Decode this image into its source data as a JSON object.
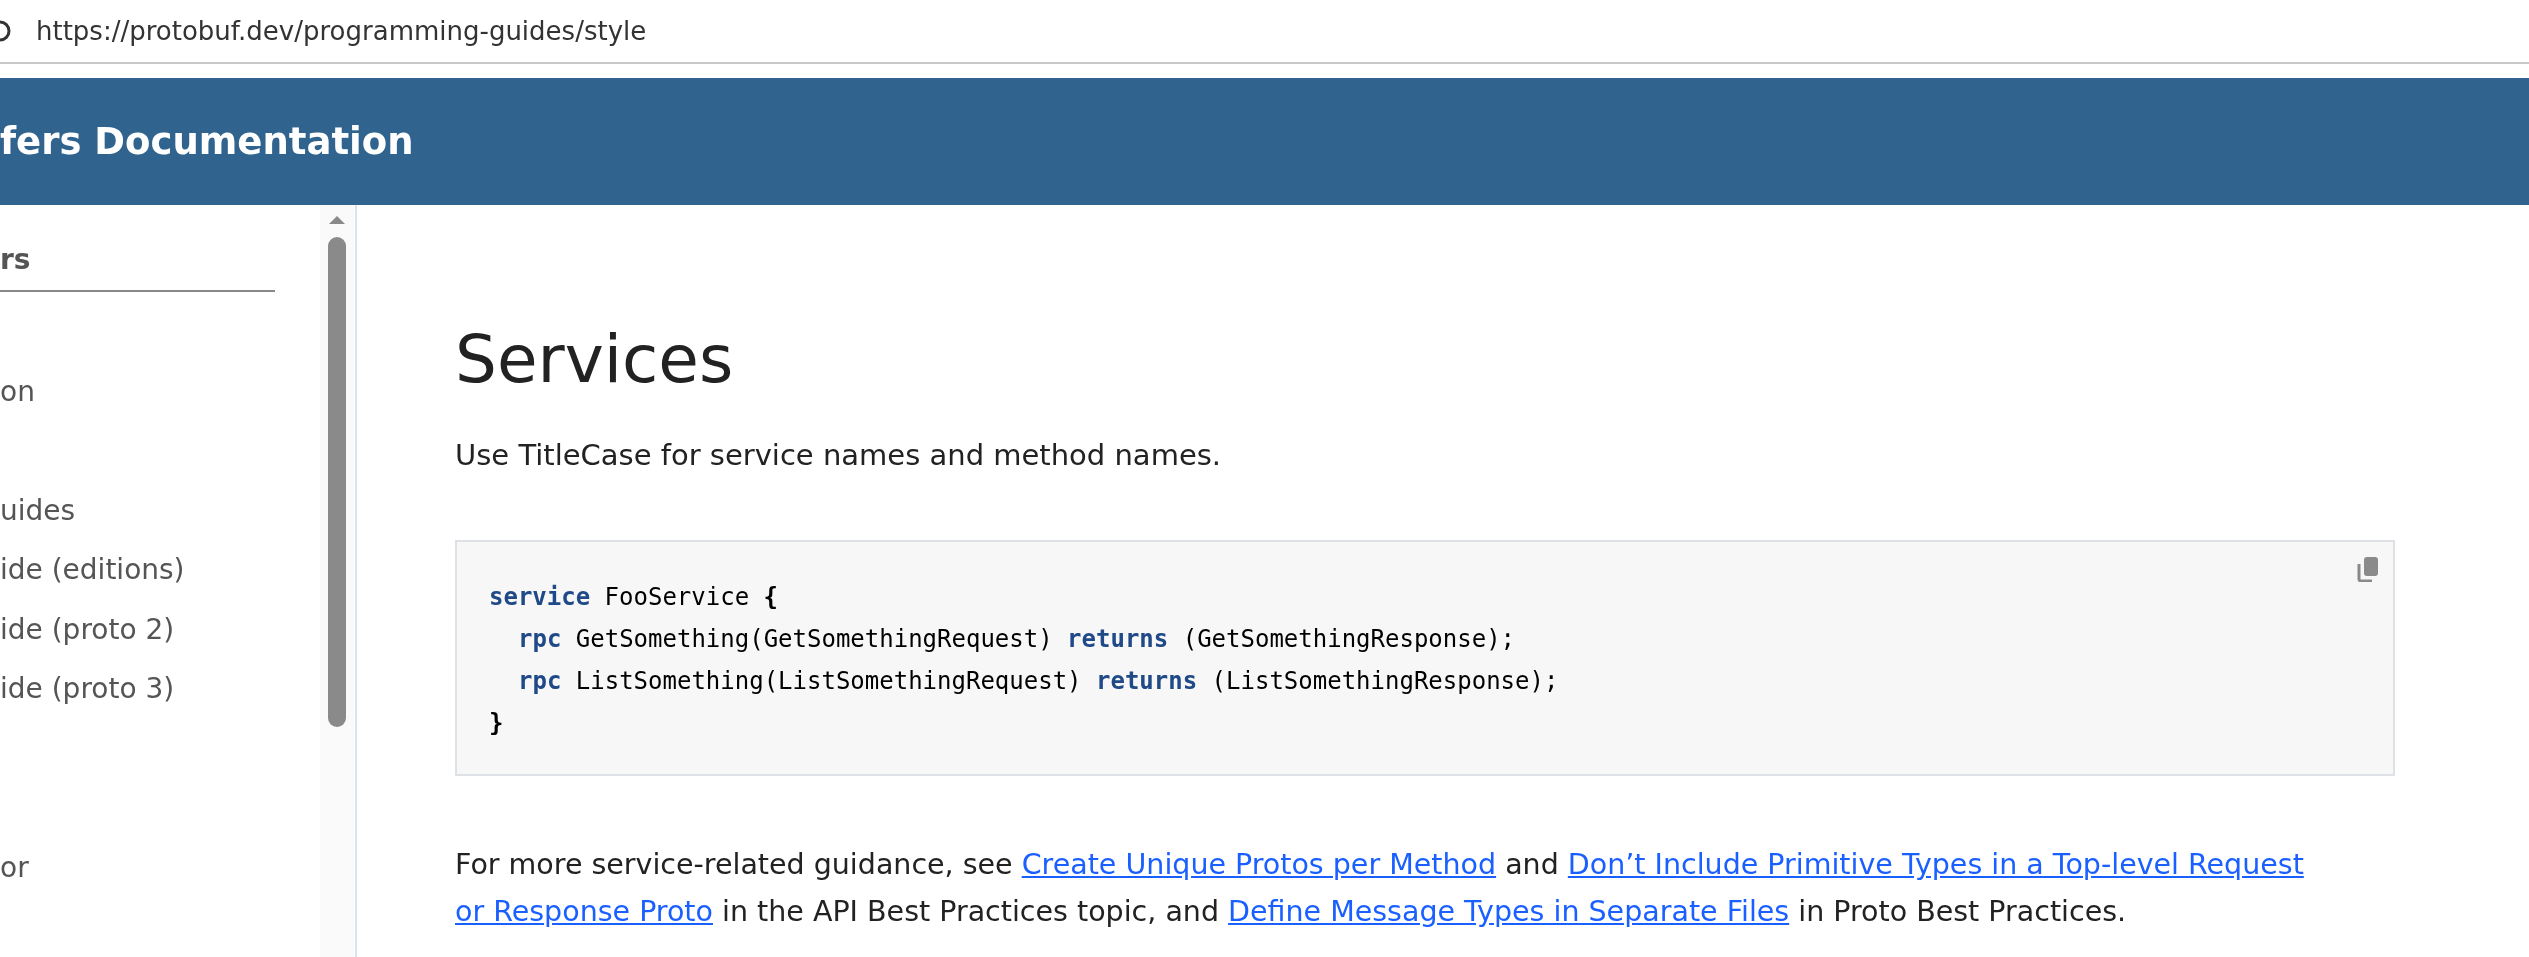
{
  "address_bar": {
    "url": "https://protobuf.dev/programming-guides/style"
  },
  "header": {
    "title": "fers Documentation"
  },
  "sidebar": {
    "section_title": "rs",
    "items": [
      {
        "kind": "spacer"
      },
      {
        "kind": "link",
        "label": "on"
      },
      {
        "kind": "spacer"
      },
      {
        "kind": "link",
        "label": "uides"
      },
      {
        "kind": "link",
        "label": "ide (editions)"
      },
      {
        "kind": "link",
        "label": "ide (proto 2)"
      },
      {
        "kind": "link",
        "label": "ide (proto 3)"
      },
      {
        "kind": "spacer"
      },
      {
        "kind": "spacer"
      },
      {
        "kind": "link",
        "label": "or"
      }
    ]
  },
  "content": {
    "heading": "Services",
    "intro": "Use TitleCase for service names and method names.",
    "code_lines": [
      {
        "indent": false,
        "tokens": [
          {
            "kind": "keyword",
            "text": "service"
          },
          {
            "kind": "plain",
            "text": " FooService "
          },
          {
            "kind": "punct",
            "text": "{"
          }
        ]
      },
      {
        "indent": true,
        "tokens": [
          {
            "kind": "keyword",
            "text": "rpc"
          },
          {
            "kind": "plain",
            "text": " GetSomething(GetSomethingRequest) "
          },
          {
            "kind": "keyword",
            "text": "returns"
          },
          {
            "kind": "plain",
            "text": " (GetSomethingResponse);"
          }
        ]
      },
      {
        "indent": true,
        "tokens": [
          {
            "kind": "keyword",
            "text": "rpc"
          },
          {
            "kind": "plain",
            "text": " ListSomething(ListSomethingRequest) "
          },
          {
            "kind": "keyword",
            "text": "returns"
          },
          {
            "kind": "plain",
            "text": " (ListSomethingResponse);"
          }
        ]
      },
      {
        "indent": false,
        "tokens": [
          {
            "kind": "punct",
            "text": "}"
          }
        ]
      }
    ],
    "paragraph": [
      {
        "kind": "text",
        "text": "For more service-related guidance, see "
      },
      {
        "kind": "link",
        "text": "Create Unique Protos per Method"
      },
      {
        "kind": "text",
        "text": " and "
      },
      {
        "kind": "link",
        "text": "Don’t Include Primitive Types in a Top-level Request"
      },
      {
        "kind": "link",
        "text": "or Response Proto"
      },
      {
        "kind": "text",
        "text": " in the API Best Practices topic, and "
      },
      {
        "kind": "link",
        "text": "Define Message Types in Separate Files"
      },
      {
        "kind": "text",
        "text": " in Proto Best Practices."
      }
    ]
  }
}
